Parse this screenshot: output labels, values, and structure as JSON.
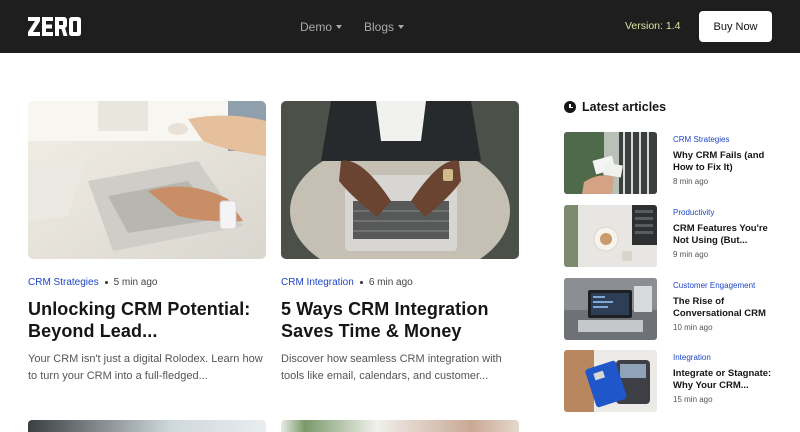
{
  "header": {
    "logo_text": "ZERO",
    "nav": [
      {
        "label": "Demo"
      },
      {
        "label": "Blogs"
      }
    ],
    "version": "Version: 1.4",
    "buy_label": "Buy Now"
  },
  "posts": [
    {
      "category": "CRM Strategies",
      "time": "5 min ago",
      "title": "Unlocking CRM Potential: Beyond Lead...",
      "excerpt": "Your CRM isn't just a digital Rolodex. Learn how to turn your CRM into a full-fledged..."
    },
    {
      "category": "CRM Integration",
      "time": "6 min ago",
      "title": "5 Ways CRM Integration Saves Time & Money",
      "excerpt": "Discover how seamless CRM integration with tools like email, calendars, and customer..."
    }
  ],
  "sidebar": {
    "heading": "Latest articles",
    "items": [
      {
        "category": "CRM Strategies",
        "title": "Why CRM Fails (and How to Fix It)",
        "time": "8 min ago"
      },
      {
        "category": "Productivity",
        "title": "CRM Features You're Not Using (But...",
        "time": "9 min ago"
      },
      {
        "category": "Customer Engagement",
        "title": "The Rise of Conversational CRM",
        "time": "10 min ago"
      },
      {
        "category": "Integration",
        "title": "Integrate or Stagnate: Why Your CRM...",
        "time": "15 min ago"
      }
    ]
  }
}
